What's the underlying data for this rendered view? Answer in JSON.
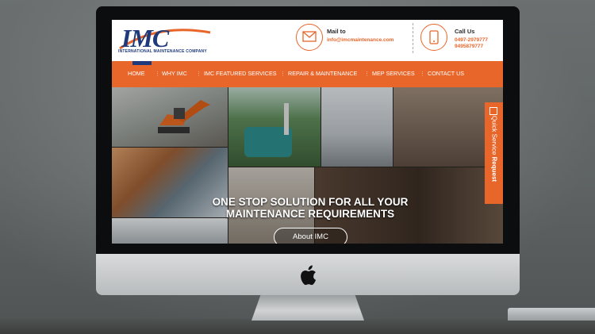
{
  "site": {
    "logo": {
      "word": "IMC",
      "subtitle": "INTERNATIONAL MAINTENANCE COMPANY"
    },
    "contact": {
      "mail": {
        "label": "Mail to",
        "value": "info@imcmaintenance.com"
      },
      "call": {
        "label": "Call Us",
        "phone1": "0497-2979777",
        "phone2": "9495879777"
      }
    },
    "nav": {
      "items": [
        {
          "label": "HOME"
        },
        {
          "label": "WHY IMC"
        },
        {
          "label": "IMC FEATURED SERVICES"
        },
        {
          "label": "REPAIR & MAINTENANCE"
        },
        {
          "label": "MEP SERVICES"
        },
        {
          "label": "CONTACT US"
        }
      ]
    },
    "hero": {
      "title_line1": "ONE STOP SOLUTION FOR ALL YOUR",
      "title_line2": "MAINTENANCE REQUIREMENTS",
      "button": "About IMC"
    },
    "side_tab": {
      "text_a": "Quick Service",
      "text_b": "Request"
    }
  },
  "colors": {
    "accent": "#e8662a",
    "brand": "#1f3a7a"
  },
  "icons": [
    "envelope-icon",
    "phone-icon",
    "apple-logo-icon",
    "quick-service-icon"
  ]
}
